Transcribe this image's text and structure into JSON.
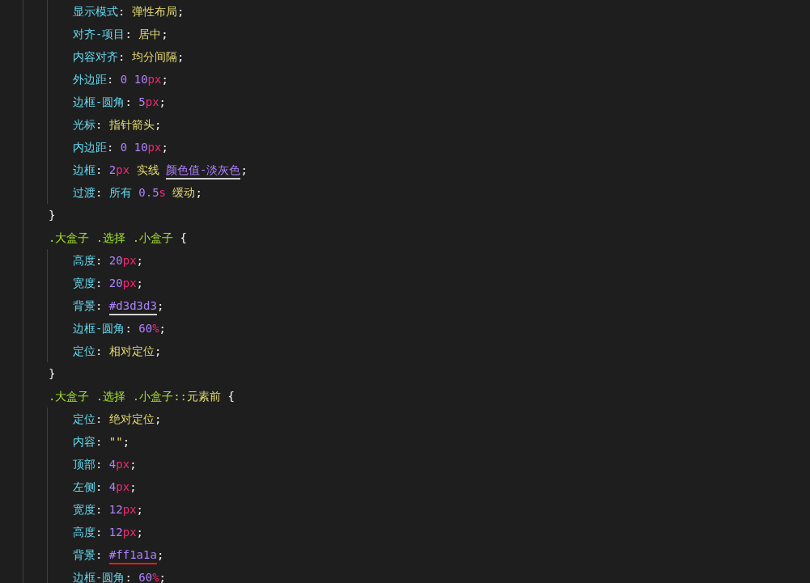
{
  "rules": [
    {
      "declarations": [
        {
          "tokens": [
            {
              "kind": "property",
              "text": "显示模式"
            },
            {
              "kind": "punct",
              "text": ":"
            },
            {
              "kind": "keyword",
              "text": " 弹性布局"
            },
            {
              "kind": "punct",
              "text": ";"
            }
          ]
        },
        {
          "tokens": [
            {
              "kind": "property",
              "text": "对齐-项目"
            },
            {
              "kind": "punct",
              "text": ":"
            },
            {
              "kind": "keyword",
              "text": " 居中"
            },
            {
              "kind": "punct",
              "text": ";"
            }
          ]
        },
        {
          "tokens": [
            {
              "kind": "property",
              "text": "内容对齐"
            },
            {
              "kind": "punct",
              "text": ":"
            },
            {
              "kind": "keyword",
              "text": " 均分间隔"
            },
            {
              "kind": "punct",
              "text": ";"
            }
          ]
        },
        {
          "tokens": [
            {
              "kind": "property",
              "text": "外边距"
            },
            {
              "kind": "punct",
              "text": ":"
            },
            {
              "kind": "number",
              "text": " 0 10"
            },
            {
              "kind": "unit",
              "text": "px"
            },
            {
              "kind": "punct",
              "text": ";"
            }
          ]
        },
        {
          "tokens": [
            {
              "kind": "property",
              "text": "边框-圆角"
            },
            {
              "kind": "punct",
              "text": ":"
            },
            {
              "kind": "number",
              "text": " 5"
            },
            {
              "kind": "unit",
              "text": "px"
            },
            {
              "kind": "punct",
              "text": ";"
            }
          ]
        },
        {
          "tokens": [
            {
              "kind": "property",
              "text": "光标"
            },
            {
              "kind": "punct",
              "text": ":"
            },
            {
              "kind": "keyword",
              "text": " 指针箭头"
            },
            {
              "kind": "punct",
              "text": ";"
            }
          ]
        },
        {
          "tokens": [
            {
              "kind": "property",
              "text": "内边距"
            },
            {
              "kind": "punct",
              "text": ":"
            },
            {
              "kind": "number",
              "text": " 0 10"
            },
            {
              "kind": "unit",
              "text": "px"
            },
            {
              "kind": "punct",
              "text": ";"
            }
          ]
        },
        {
          "tokens": [
            {
              "kind": "property",
              "text": "边框"
            },
            {
              "kind": "punct",
              "text": ":"
            },
            {
              "kind": "number",
              "text": " 2"
            },
            {
              "kind": "unit",
              "text": "px"
            },
            {
              "kind": "keyword",
              "text": " 实线 "
            },
            {
              "kind": "color",
              "text": "颜色值-淡灰色",
              "color": "#d3d3d3"
            },
            {
              "kind": "punct",
              "text": ";"
            }
          ]
        },
        {
          "tokens": [
            {
              "kind": "property",
              "text": "过渡"
            },
            {
              "kind": "punct",
              "text": ":"
            },
            {
              "kind": "property",
              "text": " 所有"
            },
            {
              "kind": "number",
              "text": " 0.5"
            },
            {
              "kind": "unit",
              "text": "s"
            },
            {
              "kind": "keyword",
              "text": " 缓动"
            },
            {
              "kind": "punct",
              "text": ";"
            }
          ]
        }
      ],
      "close": "}"
    },
    {
      "selector": [
        {
          "kind": "selector",
          "text": ".大盒子 .选择 .小盒子 "
        },
        {
          "kind": "punct",
          "text": "{"
        }
      ],
      "declarations": [
        {
          "tokens": [
            {
              "kind": "property",
              "text": "高度"
            },
            {
              "kind": "punct",
              "text": ":"
            },
            {
              "kind": "number",
              "text": " 20"
            },
            {
              "kind": "unit",
              "text": "px"
            },
            {
              "kind": "punct",
              "text": ";"
            }
          ]
        },
        {
          "tokens": [
            {
              "kind": "property",
              "text": "宽度"
            },
            {
              "kind": "punct",
              "text": ":"
            },
            {
              "kind": "number",
              "text": " 20"
            },
            {
              "kind": "unit",
              "text": "px"
            },
            {
              "kind": "punct",
              "text": ";"
            }
          ]
        },
        {
          "tokens": [
            {
              "kind": "property",
              "text": "背景"
            },
            {
              "kind": "punct",
              "text": ": "
            },
            {
              "kind": "color",
              "text": "#d3d3d3",
              "color": "#d3d3d3"
            },
            {
              "kind": "punct",
              "text": ";"
            }
          ]
        },
        {
          "tokens": [
            {
              "kind": "property",
              "text": "边框-圆角"
            },
            {
              "kind": "punct",
              "text": ":"
            },
            {
              "kind": "number",
              "text": " 60"
            },
            {
              "kind": "unit",
              "text": "%"
            },
            {
              "kind": "punct",
              "text": ";"
            }
          ]
        },
        {
          "tokens": [
            {
              "kind": "property",
              "text": "定位"
            },
            {
              "kind": "punct",
              "text": ":"
            },
            {
              "kind": "keyword",
              "text": " 相对定位"
            },
            {
              "kind": "punct",
              "text": ";"
            }
          ]
        }
      ],
      "close": "}"
    },
    {
      "selector": [
        {
          "kind": "selector",
          "text": ".大盒子 .选择 .小盒子::"
        },
        {
          "kind": "keyword",
          "text": "元素前 "
        },
        {
          "kind": "punct",
          "text": "{"
        }
      ],
      "declarations": [
        {
          "tokens": [
            {
              "kind": "property",
              "text": "定位"
            },
            {
              "kind": "punct",
              "text": ":"
            },
            {
              "kind": "keyword",
              "text": " 绝对定位"
            },
            {
              "kind": "punct",
              "text": ";"
            }
          ]
        },
        {
          "tokens": [
            {
              "kind": "property",
              "text": "内容"
            },
            {
              "kind": "punct",
              "text": ":"
            },
            {
              "kind": "keyword",
              "text": " \"\""
            },
            {
              "kind": "punct",
              "text": ";"
            }
          ]
        },
        {
          "tokens": [
            {
              "kind": "property",
              "text": "顶部"
            },
            {
              "kind": "punct",
              "text": ":"
            },
            {
              "kind": "number",
              "text": " 4"
            },
            {
              "kind": "unit",
              "text": "px"
            },
            {
              "kind": "punct",
              "text": ";"
            }
          ]
        },
        {
          "tokens": [
            {
              "kind": "property",
              "text": "左侧"
            },
            {
              "kind": "punct",
              "text": ":"
            },
            {
              "kind": "number",
              "text": " 4"
            },
            {
              "kind": "unit",
              "text": "px"
            },
            {
              "kind": "punct",
              "text": ";"
            }
          ]
        },
        {
          "tokens": [
            {
              "kind": "property",
              "text": "宽度"
            },
            {
              "kind": "punct",
              "text": ":"
            },
            {
              "kind": "number",
              "text": " 12"
            },
            {
              "kind": "unit",
              "text": "px"
            },
            {
              "kind": "punct",
              "text": ";"
            }
          ]
        },
        {
          "tokens": [
            {
              "kind": "property",
              "text": "高度"
            },
            {
              "kind": "punct",
              "text": ":"
            },
            {
              "kind": "number",
              "text": " 12"
            },
            {
              "kind": "unit",
              "text": "px"
            },
            {
              "kind": "punct",
              "text": ";"
            }
          ]
        },
        {
          "tokens": [
            {
              "kind": "property",
              "text": "背景"
            },
            {
              "kind": "punct",
              "text": ": "
            },
            {
              "kind": "color",
              "text": "#ff1a1a",
              "color": "#ff1a1a"
            },
            {
              "kind": "punct",
              "text": ";"
            }
          ]
        },
        {
          "tokens": [
            {
              "kind": "property",
              "text": "边框-圆角"
            },
            {
              "kind": "punct",
              "text": ":"
            },
            {
              "kind": "number",
              "text": " 60"
            },
            {
              "kind": "unit",
              "text": "%"
            },
            {
              "kind": "punct",
              "text": ";"
            }
          ]
        }
      ]
    }
  ]
}
